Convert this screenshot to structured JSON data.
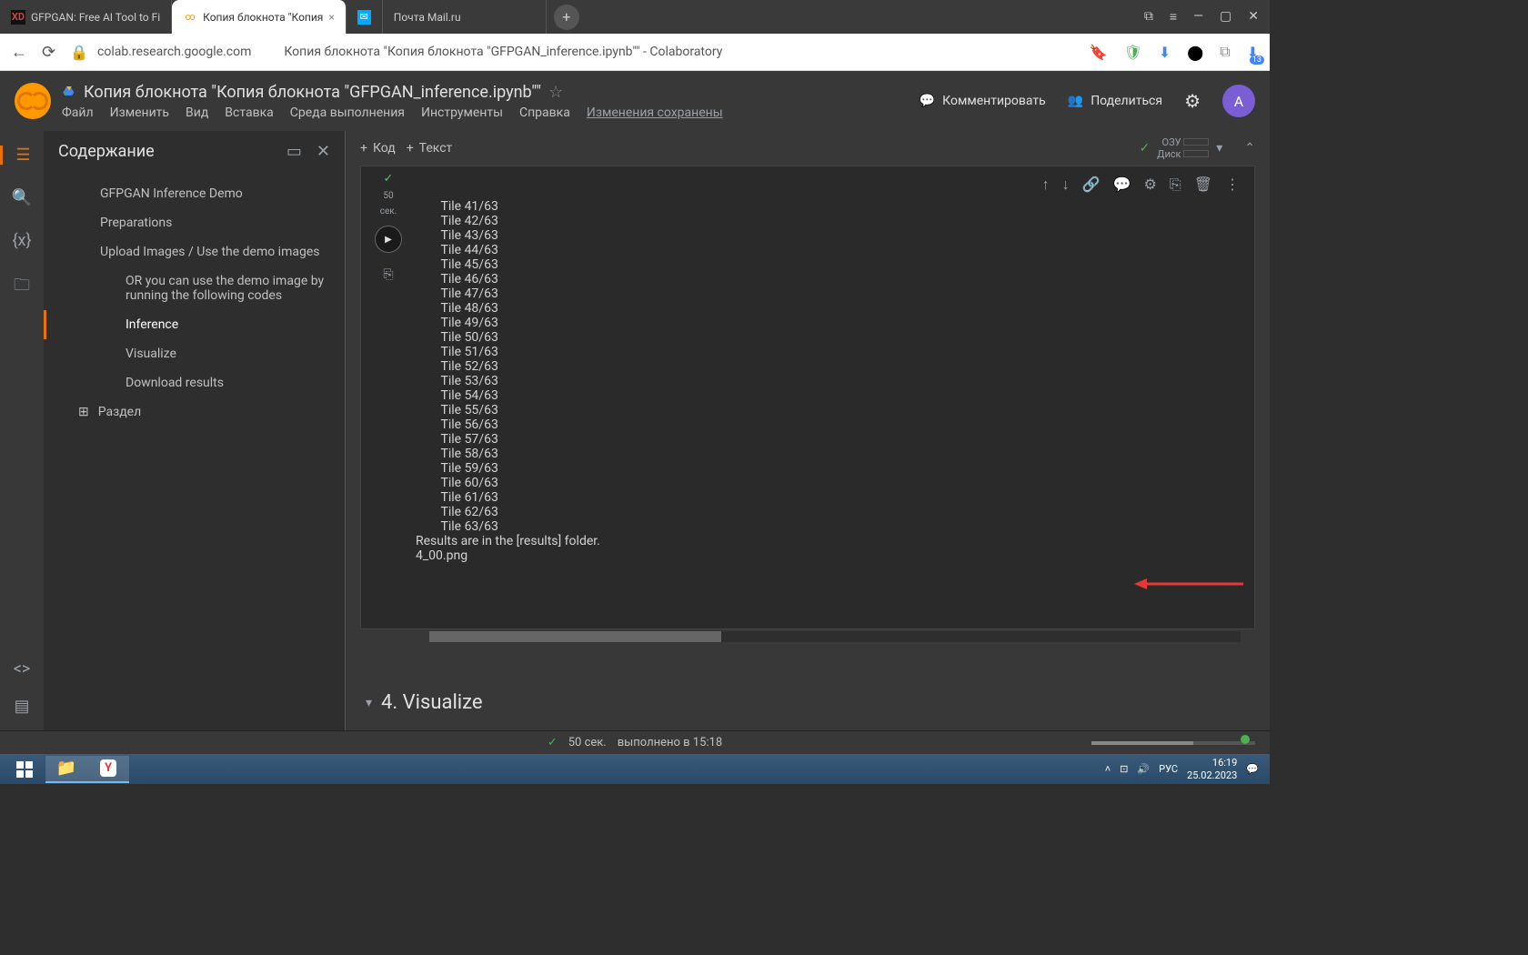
{
  "browser": {
    "tabs": [
      {
        "favicon": "XD",
        "title": "GFPGAN: Free AI Tool to Fi"
      },
      {
        "favicon": "∞",
        "title": "Копия блокнота \"Копия"
      },
      {
        "favicon": "✉",
        "title": ""
      },
      {
        "favicon": "",
        "title": "Почта Mail.ru"
      }
    ],
    "url_host": "colab.research.google.com",
    "page_title": "Копия блокнота \"Копия блокнота \"GFPGAN_inference.ipynb\"\" - Colaboratory",
    "ext_badge": "13"
  },
  "colab": {
    "doc_title": "Копия блокнота \"Копия блокнота \"GFPGAN_inference.ipynb\"\"",
    "menu": [
      "Файл",
      "Изменить",
      "Вид",
      "Вставка",
      "Среда выполнения",
      "Инструменты",
      "Справка"
    ],
    "saved_label": "Изменения сохранены",
    "comment_label": "Комментировать",
    "share_label": "Поделиться",
    "avatar_letter": "A"
  },
  "sidebar": {
    "title": "Содержание",
    "items": [
      {
        "label": "GFPGAN Inference Demo",
        "lvl": 1
      },
      {
        "label": "Preparations",
        "lvl": 1
      },
      {
        "label": "Upload Images / Use the demo images",
        "lvl": 1
      },
      {
        "label": "OR you can use the demo image by running the following codes",
        "lvl": 2
      },
      {
        "label": "Inference",
        "lvl": 2,
        "active": true
      },
      {
        "label": "Visualize",
        "lvl": 2
      },
      {
        "label": "Download results",
        "lvl": 2
      }
    ],
    "section_label": "Раздел"
  },
  "toolbar": {
    "code_label": "Код",
    "text_label": "Текст",
    "ram_label": "ОЗУ",
    "disk_label": "Диск"
  },
  "cell": {
    "exec_time": "50",
    "exec_time_unit": "сек.",
    "output_lines": [
      "        Tile 41/63",
      "        Tile 42/63",
      "        Tile 43/63",
      "        Tile 44/63",
      "        Tile 45/63",
      "        Tile 46/63",
      "        Tile 47/63",
      "        Tile 48/63",
      "        Tile 49/63",
      "        Tile 50/63",
      "        Tile 51/63",
      "        Tile 52/63",
      "        Tile 53/63",
      "        Tile 54/63",
      "        Tile 55/63",
      "        Tile 56/63",
      "        Tile 57/63",
      "        Tile 58/63",
      "        Tile 59/63",
      "        Tile 60/63",
      "        Tile 61/63",
      "        Tile 62/63",
      "        Tile 63/63",
      "Results are in the [results] folder.",
      "4_00.png"
    ]
  },
  "next_section": "4. Visualize",
  "status": {
    "time": "50 сек.",
    "text": "выполнено в 15:18"
  },
  "taskbar": {
    "lang": "РУС",
    "time": "16:19",
    "date": "25.02.2023"
  }
}
